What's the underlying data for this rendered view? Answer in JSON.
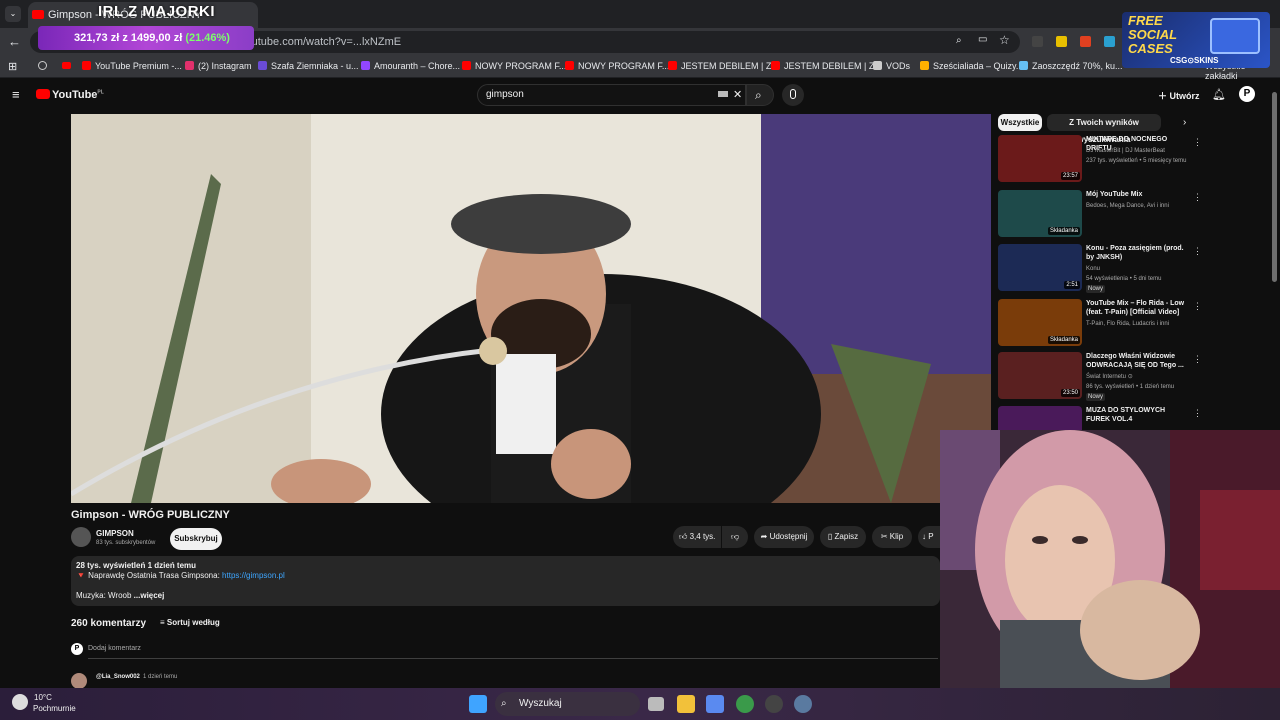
{
  "browser": {
    "tab_title": "Gimpson - WRÓG PUBLICZNY",
    "url": "youtube.com/watch?v=...lxNZmE",
    "bookmarks": [
      {
        "label": "YouTube Premium -...",
        "color": "#ff0000"
      },
      {
        "label": "(2) Instagram",
        "color": "#e1306c"
      },
      {
        "label": "Szafa Ziemniaka - u...",
        "color": "#6a4bd6"
      },
      {
        "label": "Amouranth – Chore...",
        "color": "#9146ff"
      },
      {
        "label": "NOWY PROGRAM F...",
        "color": "#ff0000"
      },
      {
        "label": "NOWY PROGRAM F...",
        "color": "#ff0000"
      },
      {
        "label": "JESTEM DEBILEM | Z...",
        "color": "#ff0000"
      },
      {
        "label": "JESTEM DEBILEM | Z...",
        "color": "#ff0000"
      },
      {
        "label": "VODs",
        "color": "#cccccc"
      },
      {
        "label": "Sześcialiada – Quizy...",
        "color": "#ffb000"
      },
      {
        "label": "Zaoszczędź 70%, ku...",
        "color": "#66c0f4"
      }
    ],
    "all_bookmarks": "Wszystkie zakładki"
  },
  "overlay": {
    "title": "IRL Z MAJORKI",
    "amount": "321,73 zł",
    "of": "z",
    "goal": "1499,00 zł",
    "percent": "(21.46%)",
    "ad_line1": "FREE",
    "ad_line2": "SOCIAL",
    "ad_line3": "CASES",
    "ad_brand": "CSG⊙SKINS"
  },
  "youtube": {
    "logo": "YouTube",
    "region": "PL",
    "search_value": "gimpson",
    "create_label": "Utwórz",
    "video_title": "Gimpson - WRÓG PUBLICZNY",
    "channel_name": "GIMPSON",
    "subscribers": "83 tys. subskrybentów",
    "subscribe": "Subskrybuj",
    "likes": "3,4 tys.",
    "share": "Udostępnij",
    "save": "Zapisz",
    "clip": "Klip",
    "download": "P",
    "views_date": "28 tys. wyświetleń  1 dzień temu",
    "desc_line": "🔻 Naprawdę Ostatnia Trasa Gimpsona:",
    "desc_link": "https://gimpson.pl",
    "desc_music": "Muzyka: Wroob",
    "more": "...więcej",
    "comments_count": "260 komentarzy",
    "sort": "Sortuj według",
    "add_comment": "Dodaj komentarz",
    "comment_user": "@Lia_Snow002",
    "comment_time": "1 dzień temu",
    "filters": [
      "Wszystkie",
      "Z Twoich wyników wyszukiwania"
    ],
    "recommendations": [
      {
        "title": "MIXTAPE DO NOCNEGO DRIFTU",
        "meta1": "DJ MasterBit | DJ MasterBeat",
        "meta2": "237 tys. wyświetleń • 5 miesięcy temu",
        "duration": "23:57",
        "color": "#6b1a1a"
      },
      {
        "title": "Mój YouTube Mix",
        "meta1": "Bedoes, Mega Dance, Avi i inni",
        "meta2": "",
        "duration": "Składanka",
        "color": "#1e4a4a"
      },
      {
        "title": "Konu - Poza zasięgiem (prod. by JNKSH)",
        "meta1": "Konu",
        "meta2": "54 wyświetlenia • 5 dni temu",
        "badge": "Nowy",
        "duration": "2:51",
        "color": "#1c2a55"
      },
      {
        "title": "YouTube Mix – Flo Rida - Low (feat. T-Pain) [Official Video]",
        "meta1": "T-Pain, Flo Rida, Ludacris i inni",
        "meta2": "",
        "duration": "Składanka",
        "color": "#7a3c0a"
      },
      {
        "title": "Dlaczego Właśni Widzowie ODWRACAJĄ SIĘ OD Tego ...",
        "meta1": "Świat Internetu ⊙",
        "meta2": "86 tys. wyświetleń • 1 dzień temu",
        "badge": "Nowy",
        "duration": "23:50",
        "color": "#5a2020"
      },
      {
        "title": "MUZA DO STYLOWYCH FUREK VOL.4",
        "meta1": "",
        "meta2": "",
        "duration": "",
        "color": "#4a1a5a"
      }
    ]
  },
  "taskbar": {
    "temp": "10°C",
    "weather": "Pochmurnie",
    "search": "Wyszukaj"
  }
}
